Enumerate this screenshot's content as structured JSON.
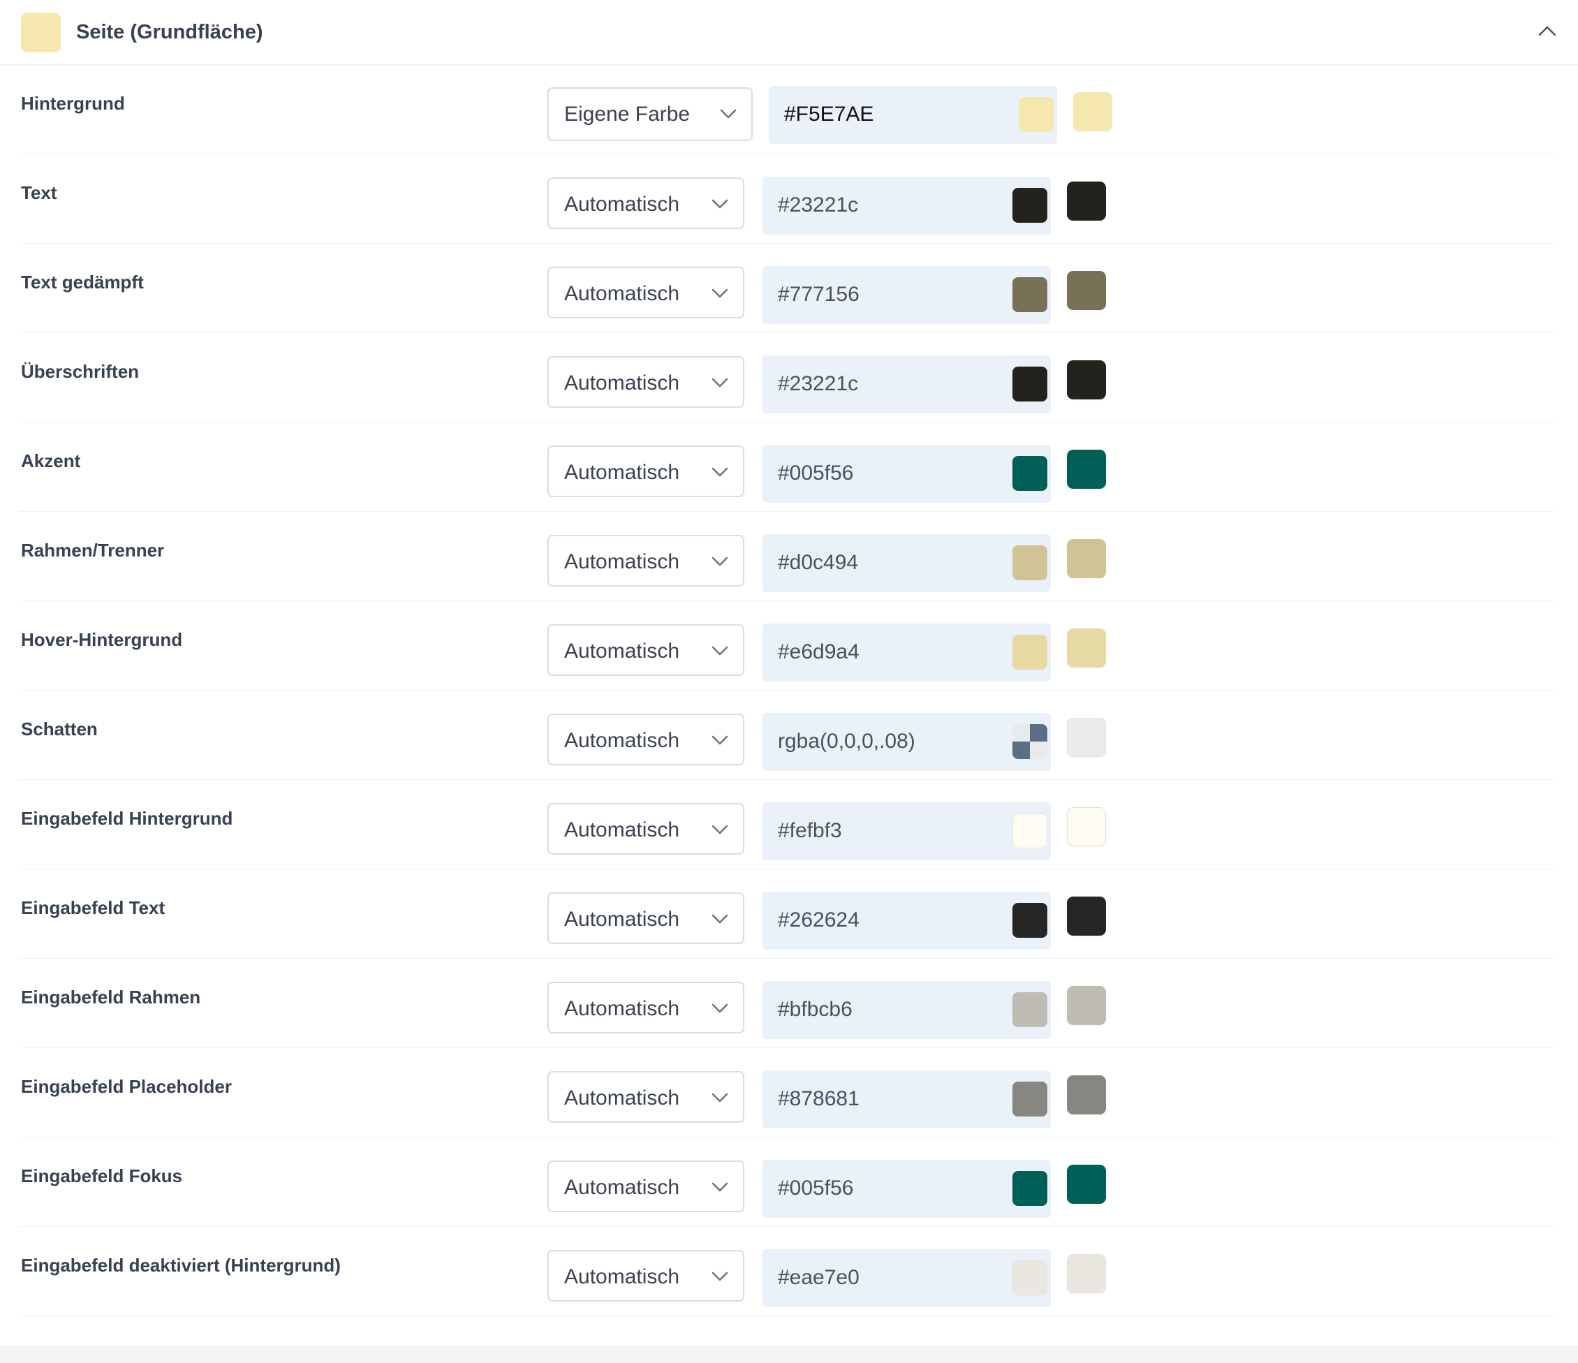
{
  "section": {
    "title": "Seite (Grundfläche)",
    "swatch_color": "#F5E7AE"
  },
  "rows": [
    {
      "label": "Hintergrund",
      "mode": "Eigene Farbe",
      "value": "#F5E7AE",
      "color": "#F5E7AE"
    },
    {
      "label": "Text",
      "mode": "Automatisch",
      "value": "#23221c",
      "color": "#23221c"
    },
    {
      "label": "Text gedämpft",
      "mode": "Automatisch",
      "value": "#777156",
      "color": "#777156"
    },
    {
      "label": "Überschriften",
      "mode": "Automatisch",
      "value": "#23221c",
      "color": "#23221c"
    },
    {
      "label": "Akzent",
      "mode": "Automatisch",
      "value": "#005f56",
      "color": "#005f56"
    },
    {
      "label": "Rahmen/Trenner",
      "mode": "Automatisch",
      "value": "#d0c494",
      "color": "#d0c494"
    },
    {
      "label": "Hover-Hintergrund",
      "mode": "Automatisch",
      "value": "#e6d9a4",
      "color": "#e6d9a4"
    },
    {
      "label": "Schatten",
      "mode": "Automatisch",
      "value": "rgba(0,0,0,.08)",
      "color": "#eaeaea"
    },
    {
      "label": "Eingabefeld Hintergrund",
      "mode": "Automatisch",
      "value": "#fefbf3",
      "color": "#fefbf3"
    },
    {
      "label": "Eingabefeld Text",
      "mode": "Automatisch",
      "value": "#262624",
      "color": "#262624"
    },
    {
      "label": "Eingabefeld Rahmen",
      "mode": "Automatisch",
      "value": "#bfbcb6",
      "color": "#bfbcb6"
    },
    {
      "label": "Eingabefeld Placeholder",
      "mode": "Automatisch",
      "value": "#878681",
      "color": "#878681"
    },
    {
      "label": "Eingabefeld Fokus",
      "mode": "Automatisch",
      "value": "#005f56",
      "color": "#005f56"
    },
    {
      "label": "Eingabefeld deaktiviert (Hintergrund)",
      "mode": "Automatisch",
      "value": "#eae7e0",
      "color": "#eae7e0"
    }
  ]
}
